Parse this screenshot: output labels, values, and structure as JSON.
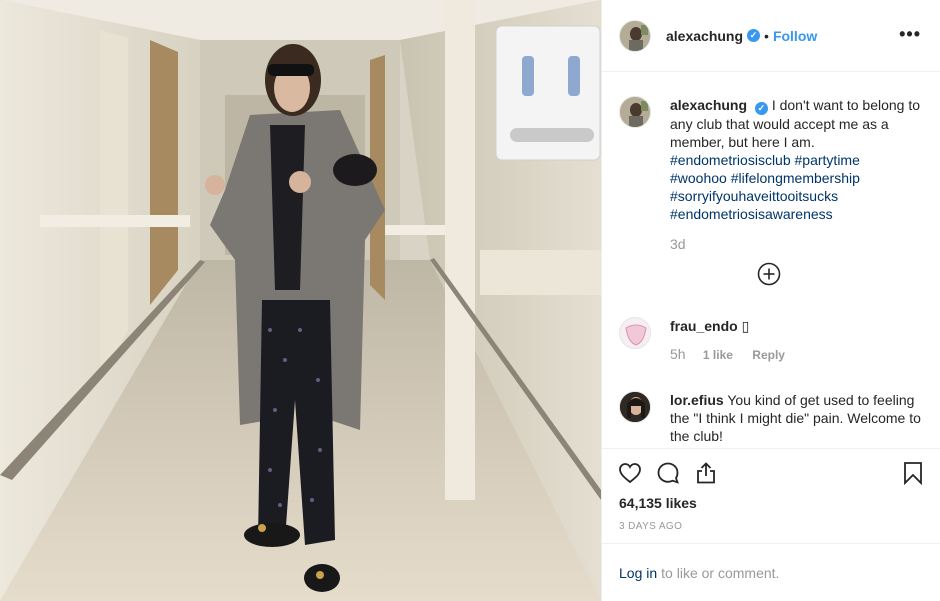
{
  "header": {
    "username": "alexachung",
    "verified_mark": "✓",
    "separator": "•",
    "follow_label": "Follow",
    "more_label": "•••"
  },
  "caption": {
    "username": "alexachung",
    "text": "I don't want to belong to any club that would accept me as a member, but here I am.",
    "hashtags": [
      "#endometriosisclub",
      "#partytime",
      "#woohoo",
      "#lifelongmembership",
      "#sorryifyouhaveittooitsucks",
      "#endometriosisawareness"
    ],
    "time": "3d"
  },
  "comments": [
    {
      "username": "frau_endo",
      "text": "▯",
      "time": "5h",
      "likes": "1 like",
      "reply": "Reply"
    },
    {
      "username": "lor.efius",
      "text": "You kind of get used to feeling the \"I think I might die\" pain. Welcome to the club!"
    }
  ],
  "actions": {
    "icons": [
      "heart-icon",
      "comment-icon",
      "share-icon",
      "bookmark-icon"
    ],
    "likes": "64,135 likes",
    "posted": "3 DAYS AGO"
  },
  "login": {
    "link": "Log in",
    "text": "to like or comment."
  },
  "colors": {
    "link": "#003569",
    "accent": "#3897f0",
    "muted": "#999999"
  }
}
